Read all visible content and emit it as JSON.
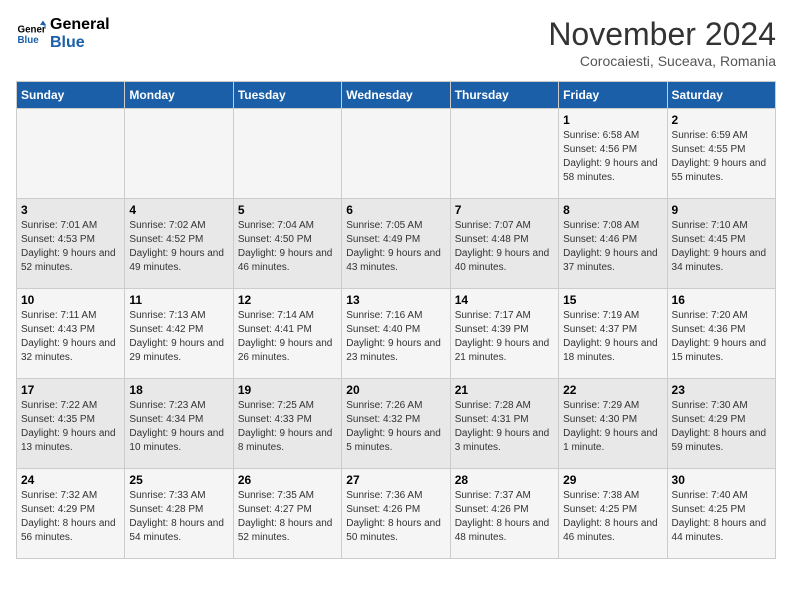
{
  "logo": {
    "text_general": "General",
    "text_blue": "Blue"
  },
  "title": "November 2024",
  "subtitle": "Corocaiesti, Suceava, Romania",
  "weekdays": [
    "Sunday",
    "Monday",
    "Tuesday",
    "Wednesday",
    "Thursday",
    "Friday",
    "Saturday"
  ],
  "weeks": [
    [
      {
        "day": "",
        "info": ""
      },
      {
        "day": "",
        "info": ""
      },
      {
        "day": "",
        "info": ""
      },
      {
        "day": "",
        "info": ""
      },
      {
        "day": "",
        "info": ""
      },
      {
        "day": "1",
        "info": "Sunrise: 6:58 AM\nSunset: 4:56 PM\nDaylight: 9 hours and 58 minutes."
      },
      {
        "day": "2",
        "info": "Sunrise: 6:59 AM\nSunset: 4:55 PM\nDaylight: 9 hours and 55 minutes."
      }
    ],
    [
      {
        "day": "3",
        "info": "Sunrise: 7:01 AM\nSunset: 4:53 PM\nDaylight: 9 hours and 52 minutes."
      },
      {
        "day": "4",
        "info": "Sunrise: 7:02 AM\nSunset: 4:52 PM\nDaylight: 9 hours and 49 minutes."
      },
      {
        "day": "5",
        "info": "Sunrise: 7:04 AM\nSunset: 4:50 PM\nDaylight: 9 hours and 46 minutes."
      },
      {
        "day": "6",
        "info": "Sunrise: 7:05 AM\nSunset: 4:49 PM\nDaylight: 9 hours and 43 minutes."
      },
      {
        "day": "7",
        "info": "Sunrise: 7:07 AM\nSunset: 4:48 PM\nDaylight: 9 hours and 40 minutes."
      },
      {
        "day": "8",
        "info": "Sunrise: 7:08 AM\nSunset: 4:46 PM\nDaylight: 9 hours and 37 minutes."
      },
      {
        "day": "9",
        "info": "Sunrise: 7:10 AM\nSunset: 4:45 PM\nDaylight: 9 hours and 34 minutes."
      }
    ],
    [
      {
        "day": "10",
        "info": "Sunrise: 7:11 AM\nSunset: 4:43 PM\nDaylight: 9 hours and 32 minutes."
      },
      {
        "day": "11",
        "info": "Sunrise: 7:13 AM\nSunset: 4:42 PM\nDaylight: 9 hours and 29 minutes."
      },
      {
        "day": "12",
        "info": "Sunrise: 7:14 AM\nSunset: 4:41 PM\nDaylight: 9 hours and 26 minutes."
      },
      {
        "day": "13",
        "info": "Sunrise: 7:16 AM\nSunset: 4:40 PM\nDaylight: 9 hours and 23 minutes."
      },
      {
        "day": "14",
        "info": "Sunrise: 7:17 AM\nSunset: 4:39 PM\nDaylight: 9 hours and 21 minutes."
      },
      {
        "day": "15",
        "info": "Sunrise: 7:19 AM\nSunset: 4:37 PM\nDaylight: 9 hours and 18 minutes."
      },
      {
        "day": "16",
        "info": "Sunrise: 7:20 AM\nSunset: 4:36 PM\nDaylight: 9 hours and 15 minutes."
      }
    ],
    [
      {
        "day": "17",
        "info": "Sunrise: 7:22 AM\nSunset: 4:35 PM\nDaylight: 9 hours and 13 minutes."
      },
      {
        "day": "18",
        "info": "Sunrise: 7:23 AM\nSunset: 4:34 PM\nDaylight: 9 hours and 10 minutes."
      },
      {
        "day": "19",
        "info": "Sunrise: 7:25 AM\nSunset: 4:33 PM\nDaylight: 9 hours and 8 minutes."
      },
      {
        "day": "20",
        "info": "Sunrise: 7:26 AM\nSunset: 4:32 PM\nDaylight: 9 hours and 5 minutes."
      },
      {
        "day": "21",
        "info": "Sunrise: 7:28 AM\nSunset: 4:31 PM\nDaylight: 9 hours and 3 minutes."
      },
      {
        "day": "22",
        "info": "Sunrise: 7:29 AM\nSunset: 4:30 PM\nDaylight: 9 hours and 1 minute."
      },
      {
        "day": "23",
        "info": "Sunrise: 7:30 AM\nSunset: 4:29 PM\nDaylight: 8 hours and 59 minutes."
      }
    ],
    [
      {
        "day": "24",
        "info": "Sunrise: 7:32 AM\nSunset: 4:29 PM\nDaylight: 8 hours and 56 minutes."
      },
      {
        "day": "25",
        "info": "Sunrise: 7:33 AM\nSunset: 4:28 PM\nDaylight: 8 hours and 54 minutes."
      },
      {
        "day": "26",
        "info": "Sunrise: 7:35 AM\nSunset: 4:27 PM\nDaylight: 8 hours and 52 minutes."
      },
      {
        "day": "27",
        "info": "Sunrise: 7:36 AM\nSunset: 4:26 PM\nDaylight: 8 hours and 50 minutes."
      },
      {
        "day": "28",
        "info": "Sunrise: 7:37 AM\nSunset: 4:26 PM\nDaylight: 8 hours and 48 minutes."
      },
      {
        "day": "29",
        "info": "Sunrise: 7:38 AM\nSunset: 4:25 PM\nDaylight: 8 hours and 46 minutes."
      },
      {
        "day": "30",
        "info": "Sunrise: 7:40 AM\nSunset: 4:25 PM\nDaylight: 8 hours and 44 minutes."
      }
    ]
  ]
}
